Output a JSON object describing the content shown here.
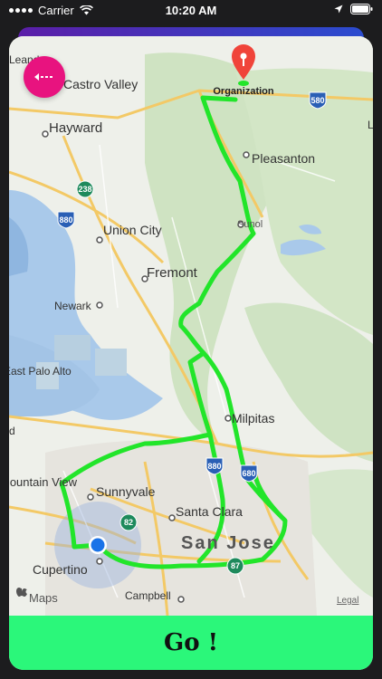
{
  "status": {
    "carrier": "Carrier",
    "time": "10:20 AM"
  },
  "map": {
    "destination_label": "Organization",
    "places": {
      "castro_valley": "Castro Valley",
      "hayward": "Hayward",
      "pleasanton": "Pleasanton",
      "union_city": "Union City",
      "sunol": "Sunol",
      "fremont": "Fremont",
      "newark": "Newark",
      "east_palo_alto": "East Palo Alto",
      "milpitas": "Milpitas",
      "mountain_view": "Mountain View",
      "sunnyvale": "Sunnyvale",
      "santa_clara": "Santa Clara",
      "san_jose": "San Jose",
      "cupertino": "Cupertino",
      "campbell": "Campbell",
      "leandro": "Leandro",
      "rd": "rd",
      "l_edge": "L"
    },
    "highways": {
      "h580": "580",
      "h238": "238",
      "h880a": "880",
      "h880b": "880",
      "h680": "680",
      "h82": "82",
      "h87": "87"
    },
    "attribution": "Maps",
    "legal": "Legal"
  },
  "actions": {
    "go_label": "Go !"
  },
  "colors": {
    "route": "#22e52a",
    "back_button": "#e8137f",
    "go_bar": "#2bf77a",
    "user_dot": "#1a73e8",
    "pin": "#f0443a"
  }
}
